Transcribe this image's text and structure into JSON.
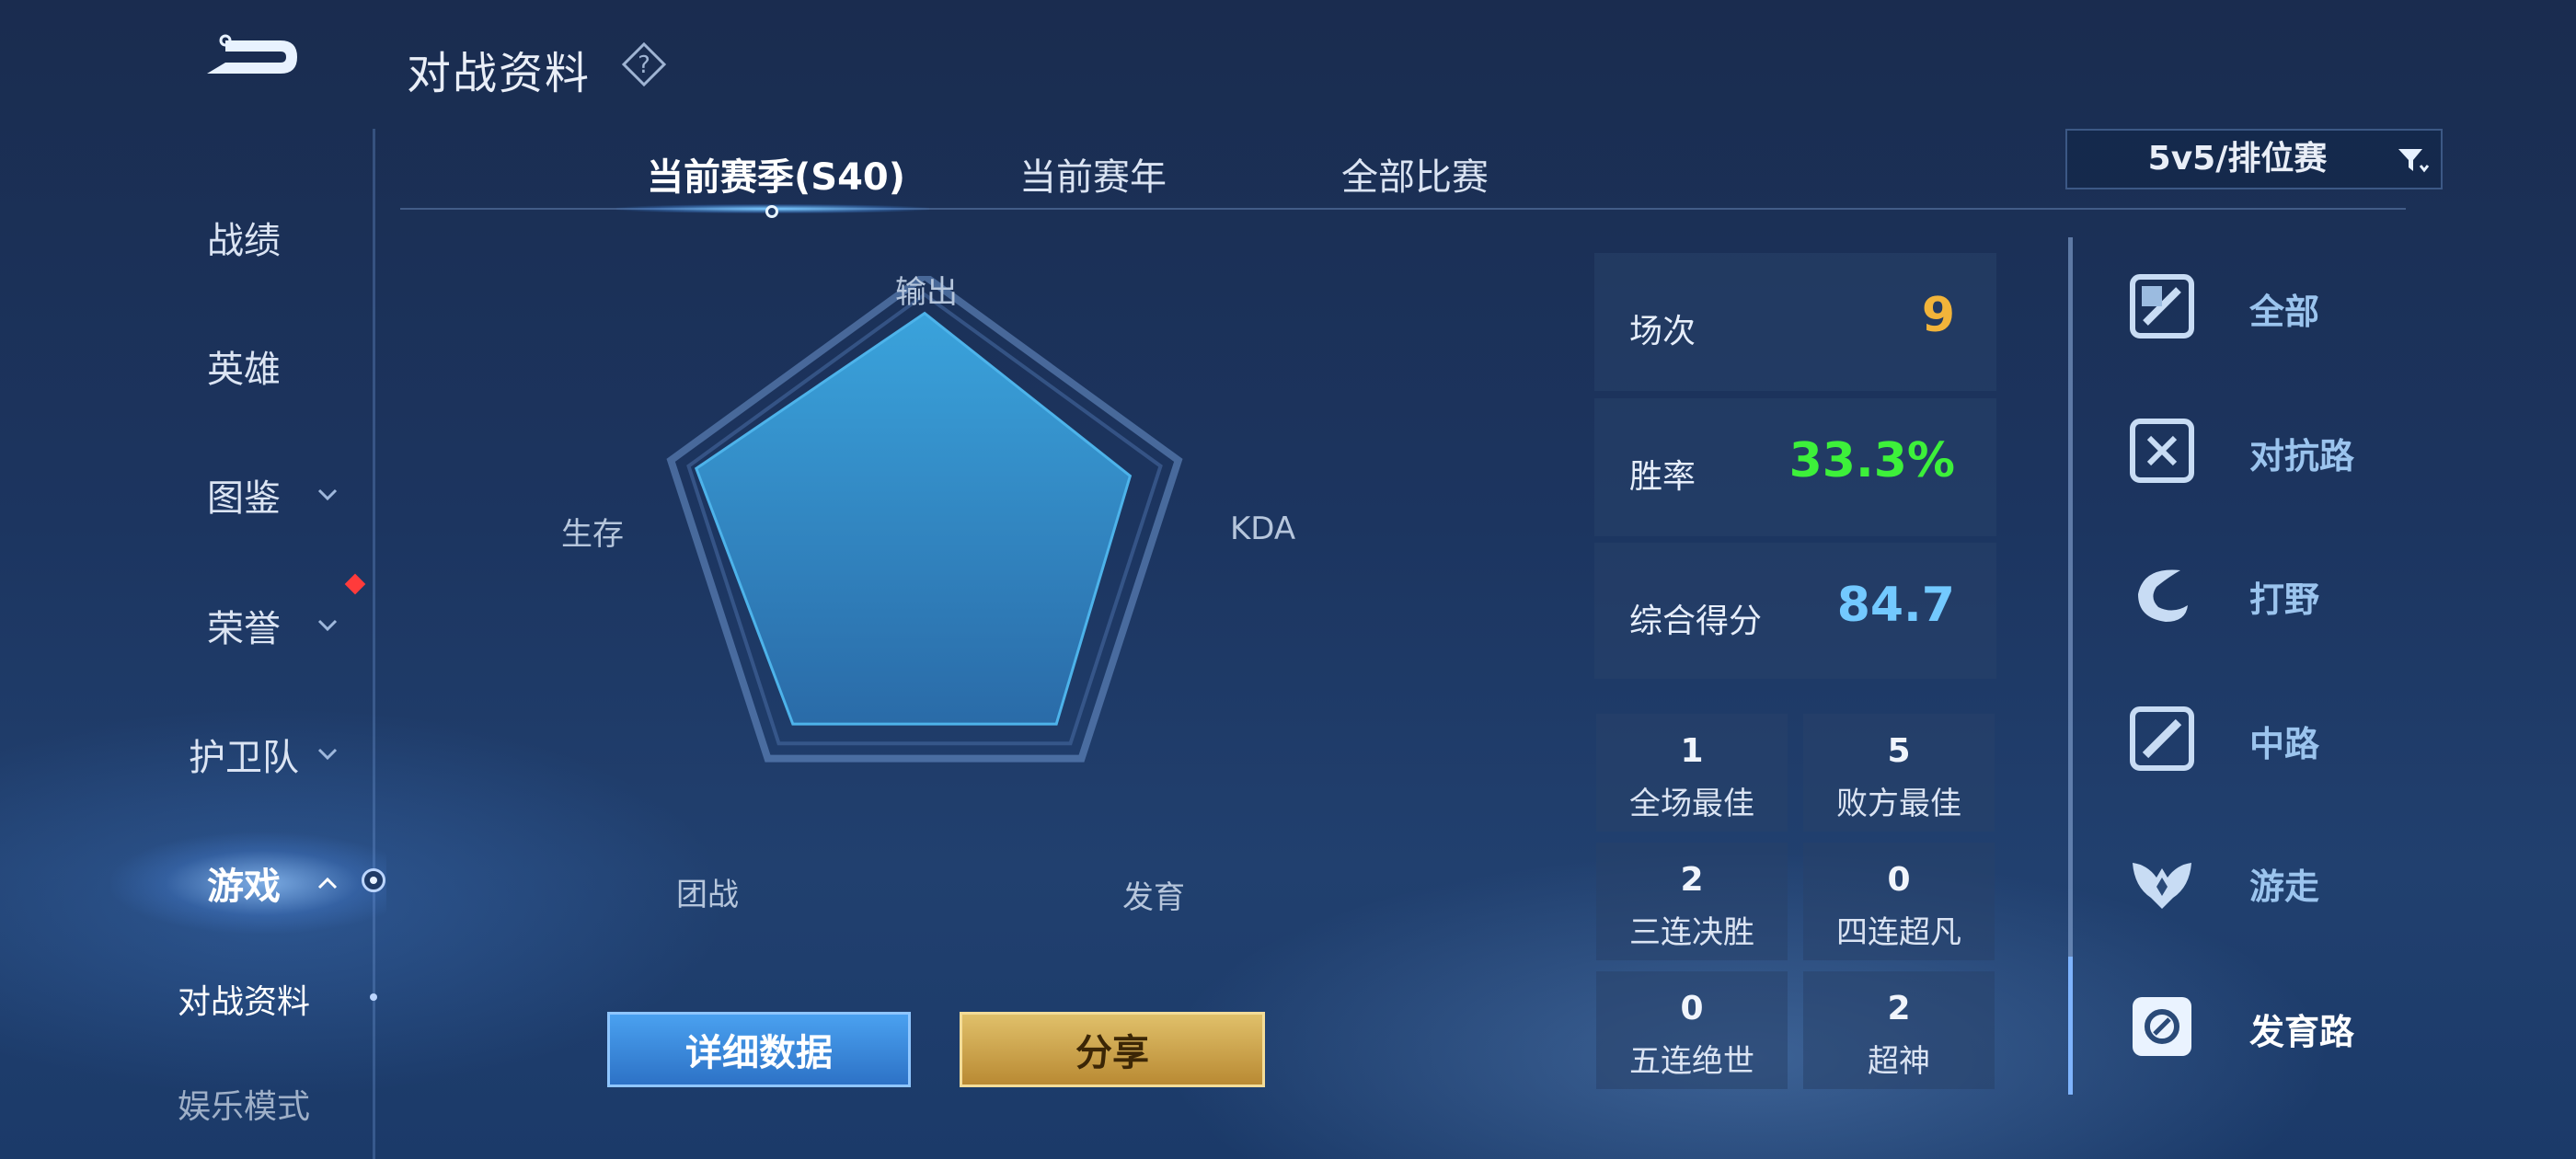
{
  "header": {
    "title": "对战资料"
  },
  "nav": {
    "items": [
      {
        "label": "战绩"
      },
      {
        "label": "英雄"
      },
      {
        "label": "图鉴"
      },
      {
        "label": "荣誉"
      },
      {
        "label": "护卫队"
      },
      {
        "label": "游戏"
      },
      {
        "label": "对战资料"
      },
      {
        "label": "娱乐模式"
      }
    ]
  },
  "tabs": [
    {
      "label": "当前赛季(S40)"
    },
    {
      "label": "当前赛年"
    },
    {
      "label": "全部比赛"
    }
  ],
  "mode_select": {
    "value": "5v5/排位赛"
  },
  "radar": {
    "axes": [
      "输出",
      "KDA",
      "发育",
      "团战",
      "生存"
    ],
    "values": [
      0.86,
      0.81,
      0.84,
      0.84,
      0.9
    ]
  },
  "stats": {
    "matches": {
      "label": "场次",
      "value": "9",
      "color": "#f2b43a"
    },
    "win_rate": {
      "label": "胜率",
      "value": "33.3%",
      "color": "#3df03a"
    },
    "score": {
      "label": "综合得分",
      "value": "84.7",
      "color": "#73c9ff"
    }
  },
  "honors": [
    {
      "value": "1",
      "label": "全场最佳"
    },
    {
      "value": "5",
      "label": "败方最佳"
    },
    {
      "value": "2",
      "label": "三连决胜"
    },
    {
      "value": "0",
      "label": "四连超凡"
    },
    {
      "value": "0",
      "label": "五连绝世"
    },
    {
      "value": "2",
      "label": "超神"
    }
  ],
  "roles": [
    {
      "label": "全部",
      "icon": "all-roles-icon"
    },
    {
      "label": "对抗路",
      "icon": "clash-lane-icon"
    },
    {
      "label": "打野",
      "icon": "jungle-icon"
    },
    {
      "label": "中路",
      "icon": "mid-lane-icon"
    },
    {
      "label": "游走",
      "icon": "roam-icon"
    },
    {
      "label": "发育路",
      "icon": "farm-lane-icon"
    }
  ],
  "buttons": {
    "detail": "详细数据",
    "share": "分享"
  }
}
